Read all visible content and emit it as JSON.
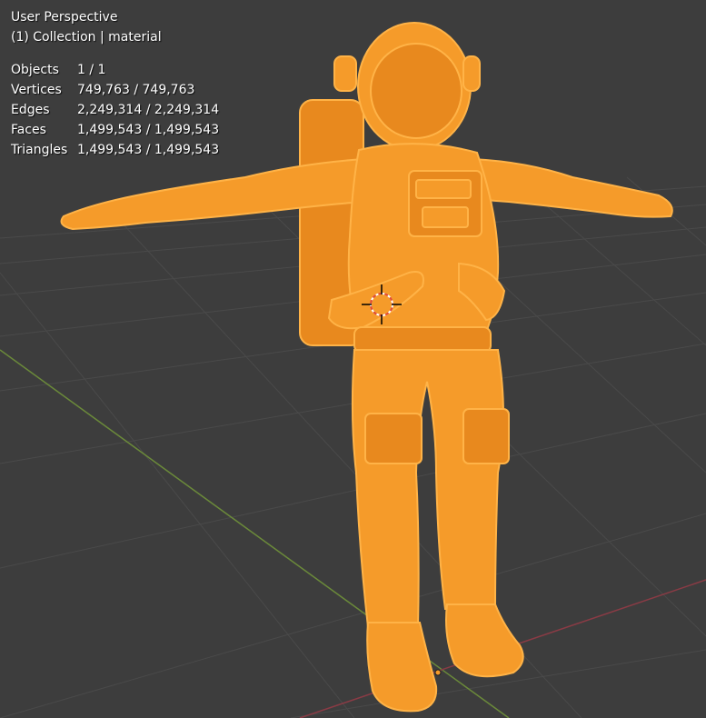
{
  "viewport": {
    "view_name": "User Perspective",
    "collection_label": "(1) Collection | material",
    "background_color": "#3d3d3d",
    "grid_color": "#4a4a4a",
    "x_axis_color": "#8a3b45",
    "y_axis_color": "#6b8a3a",
    "selection_color": "#f59b2a",
    "object": "astronaut-icon",
    "cursor": "3d-cursor-icon"
  },
  "stats": [
    {
      "label": "Objects",
      "value": "1 / 1"
    },
    {
      "label": "Vertices",
      "value": "749,763 / 749,763"
    },
    {
      "label": "Edges",
      "value": "2,249,314 / 2,249,314"
    },
    {
      "label": "Faces",
      "value": "1,499,543 / 1,499,543"
    },
    {
      "label": "Triangles",
      "value": "1,499,543 / 1,499,543"
    }
  ]
}
